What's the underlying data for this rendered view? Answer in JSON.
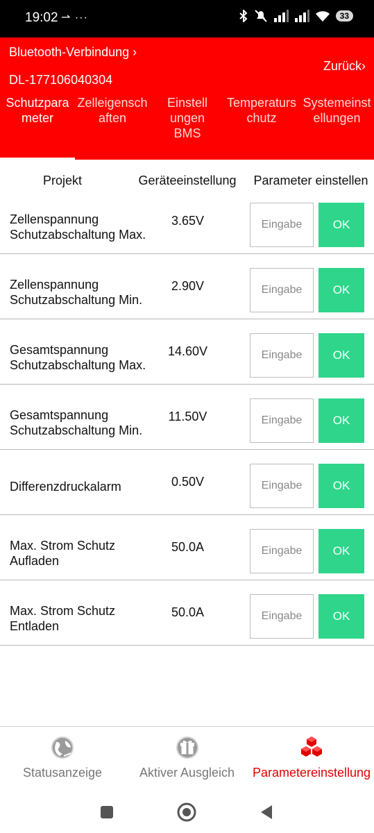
{
  "status_bar": {
    "time": "19:02",
    "extra": "⇀ ···",
    "battery": "33"
  },
  "header": {
    "bluetooth_link": "Bluetooth-Verbindung ›",
    "device_id": "DL-177106040304",
    "back_link": "Zurück›"
  },
  "tabs": [
    {
      "line1": "Schutzpara",
      "line2": "meter",
      "line3": ""
    },
    {
      "line1": "Zelleigensch",
      "line2": "aften",
      "line3": ""
    },
    {
      "line1": "Einstell",
      "line2": "ungen",
      "line3": "BMS"
    },
    {
      "line1": "Temperaturs",
      "line2": "chutz",
      "line3": ""
    },
    {
      "line1": "Systemeinst",
      "line2": "ellungen",
      "line3": ""
    }
  ],
  "table": {
    "headers": {
      "project": "Projekt",
      "device_setting": "Geräteeinstellung",
      "set_parameter": "Parameter einstellen"
    },
    "input_placeholder": "Eingabe",
    "ok_label": "OK",
    "rows": [
      {
        "line1": "Zellenspannung",
        "line2": "Schutzabschaltung Max.",
        "value": "3.65V"
      },
      {
        "line1": "Zellenspannung",
        "line2": "Schutzabschaltung Min.",
        "value": "2.90V"
      },
      {
        "line1": "Gesamtspannung",
        "line2": "Schutzabschaltung Max.",
        "value": "14.60V"
      },
      {
        "line1": "Gesamtspannung",
        "line2": "Schutzabschaltung Min.",
        "value": "11.50V"
      },
      {
        "line1": "Differenzdruckalarm",
        "line2": "",
        "value": "0.50V"
      },
      {
        "line1": "Max. Strom Schutz",
        "line2": "Aufladen",
        "value": "50.0A"
      },
      {
        "line1": "Max. Strom Schutz",
        "line2": "Entladen",
        "value": "50.0A"
      }
    ]
  },
  "bottom_nav": [
    {
      "label": "Statusanzeige",
      "icon": "globe-icon"
    },
    {
      "label": "Aktiver Ausgleich",
      "icon": "gift-icon"
    },
    {
      "label": "Parametereinstellung",
      "icon": "cubes-icon"
    }
  ],
  "colors": {
    "header": "#ff0000",
    "ok": "#2fd58a",
    "active_nav": "#e00000"
  }
}
